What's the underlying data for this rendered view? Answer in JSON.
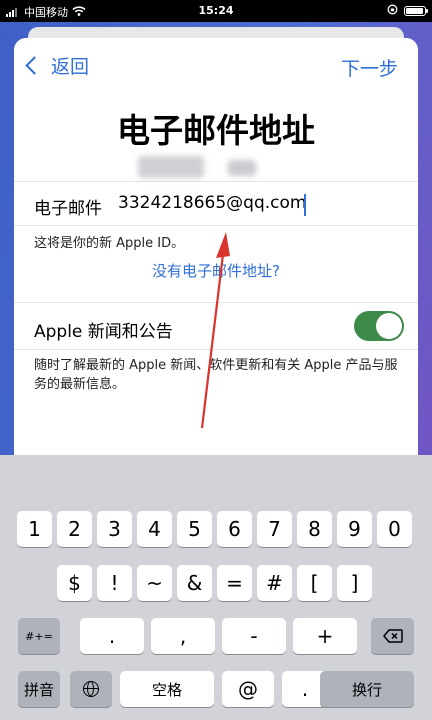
{
  "status": {
    "carrier": "中国移动",
    "time": "15:24"
  },
  "nav": {
    "back_label": "返回",
    "next_label": "下一步"
  },
  "title": "电子邮件地址",
  "email": {
    "label": "电子邮件",
    "value": "3324218665@qq.com",
    "hint": "这将是你的新 Apple ID。",
    "no_email_link": "没有电子邮件地址?"
  },
  "news": {
    "label": "Apple 新闻和公告",
    "toggle_on": true,
    "description": "随时了解最新的 Apple 新闻、软件更新和有关 Apple 产品与服务的最新信息。"
  },
  "keyboard": {
    "row1": [
      "1",
      "2",
      "3",
      "4",
      "5",
      "6",
      "7",
      "8",
      "9",
      "0"
    ],
    "row2": [
      "$",
      "!",
      "~",
      "&",
      "=",
      "#",
      "[",
      "]"
    ],
    "row3": {
      "shift": "#+=",
      "keys": [
        ".",
        ",",
        "-",
        "+"
      ]
    },
    "row4": {
      "pinyin": "拼音",
      "space": "空格",
      "at": "@",
      "dot": ".",
      "return": "换行"
    }
  },
  "colors": {
    "accent": "#2f6fd8",
    "toggle": "#3e8a4a",
    "keyboard_bg": "#d1d3d9"
  }
}
